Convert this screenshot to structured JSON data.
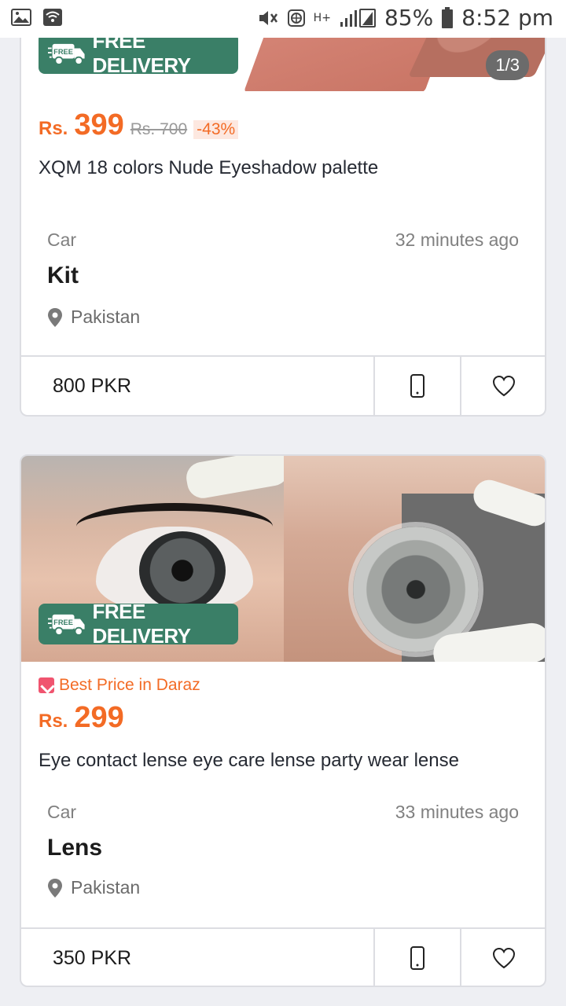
{
  "status_bar": {
    "battery": "85%",
    "time": "8:52 pm",
    "network": "H+"
  },
  "listings": [
    {
      "image_counter": "1/3",
      "badge": "FREE DELIVERY",
      "badge_truck_text": "FREE",
      "currency": "Rs.",
      "price": "399",
      "old_price": "Rs. 700",
      "discount": "-43%",
      "title": "XQM 18 colors Nude Eyeshadow palette",
      "category": "Car",
      "posted": "32 minutes ago",
      "name": "Kit",
      "location": "Pakistan",
      "footer_price": "800 PKR"
    },
    {
      "badge": "FREE DELIVERY",
      "badge_truck_text": "FREE",
      "best_price": "Best Price in Daraz",
      "currency": "Rs.",
      "price": "299",
      "title": "Eye contact lense eye care lense party wear lense",
      "category": "Car",
      "posted": "33 minutes ago",
      "name": "Lens",
      "location": "Pakistan",
      "footer_price": "350 PKR"
    }
  ],
  "colors": {
    "accent_orange": "#f36b25",
    "badge_green": "#3a7f67",
    "background": "#eeeff3"
  },
  "icons": [
    "image-icon",
    "wifi-icon",
    "mute-icon",
    "data-icon",
    "signal-icon",
    "battery-icon",
    "phone-icon",
    "heart-icon",
    "location-pin-icon",
    "truck-icon"
  ]
}
